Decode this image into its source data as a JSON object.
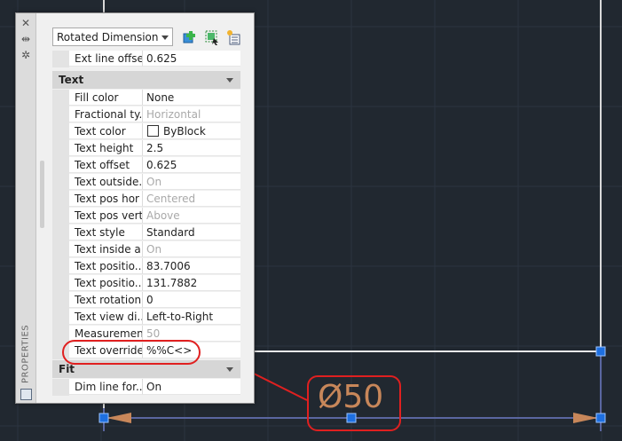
{
  "palette": {
    "side_label": "PROPERTIES",
    "object_type": "Rotated Dimension",
    "buttons": [
      "quick-select-icon",
      "select-objects-icon",
      "toggle-pickadd-icon"
    ]
  },
  "rows_top": [
    {
      "name": "Ext line offset",
      "value": "0.625"
    }
  ],
  "sections": {
    "text": "Text",
    "fit": "Fit"
  },
  "text_rows": [
    {
      "name": "Fill color",
      "value": "None",
      "disabled": false
    },
    {
      "name": "Fractional ty...",
      "value": "Horizontal",
      "disabled": true
    },
    {
      "name": "Text color",
      "value": "ByBlock",
      "disabled": false
    },
    {
      "name": "Text height",
      "value": "2.5",
      "disabled": false
    },
    {
      "name": "Text offset",
      "value": "0.625",
      "disabled": false
    },
    {
      "name": "Text  outside...",
      "value": "On",
      "disabled": true
    },
    {
      "name": "Text pos hor",
      "value": "Centered",
      "disabled": true
    },
    {
      "name": "Text pos vert",
      "value": "Above",
      "disabled": true
    },
    {
      "name": "Text style",
      "value": "Standard",
      "disabled": false
    },
    {
      "name": "Text inside a...",
      "value": "On",
      "disabled": true
    },
    {
      "name": "Text  positio...",
      "value": "83.7006",
      "disabled": false
    },
    {
      "name": "Text  positio...",
      "value": "131.7882",
      "disabled": false
    },
    {
      "name": "Text rotation",
      "value": "0",
      "disabled": false
    },
    {
      "name": "Text view di...",
      "value": "Left-to-Right",
      "disabled": false
    },
    {
      "name": "Measurement",
      "value": "50",
      "disabled": true
    },
    {
      "name": "Text override",
      "value": "%%C<>",
      "disabled": false
    }
  ],
  "fit_rows": [
    {
      "name": "Dim line for...",
      "value": "On"
    }
  ],
  "drawing": {
    "dimension_text": "Ø50",
    "dim_color": "#c8875a",
    "annotation_color": "#e02020",
    "grip_color": "#1e6fe0"
  }
}
